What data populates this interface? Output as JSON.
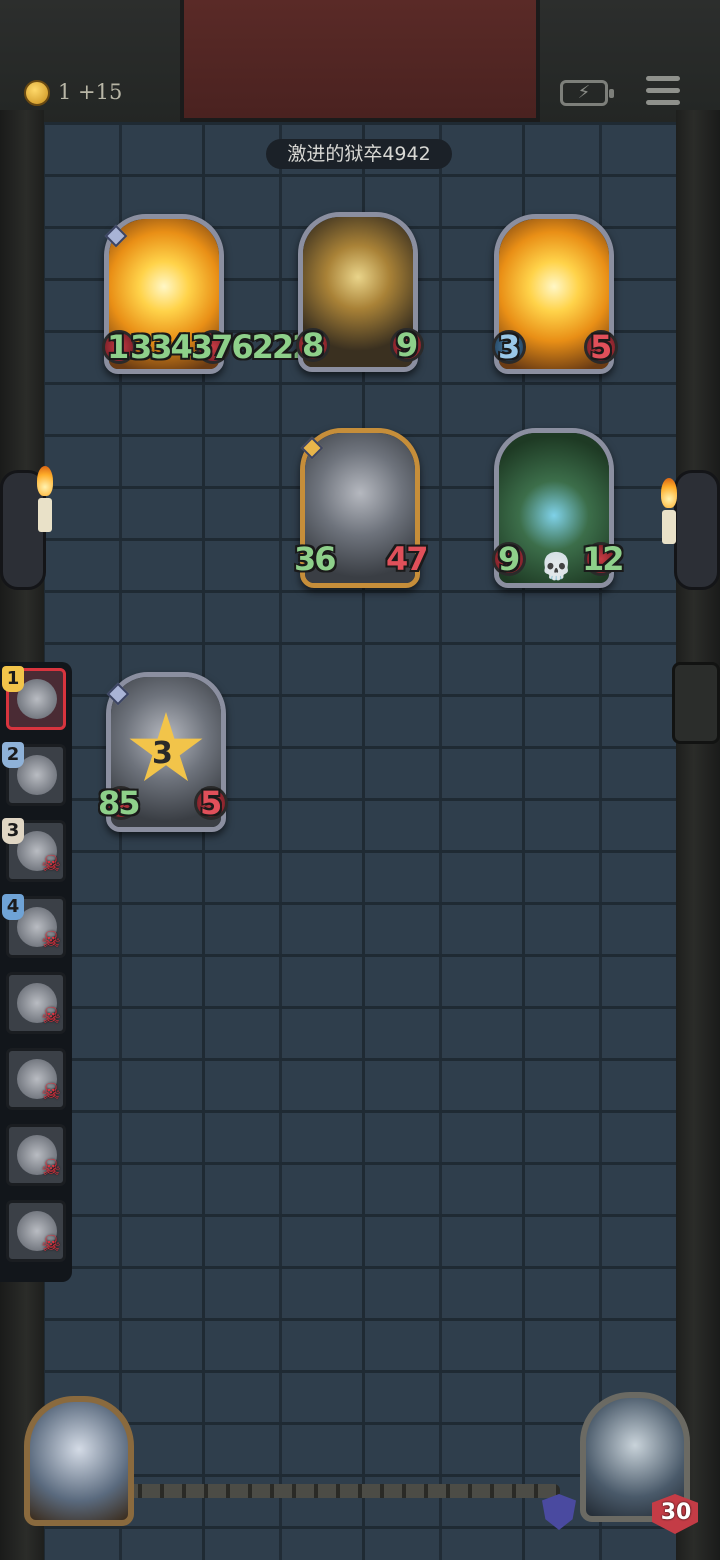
{
  "header": {
    "gold_text": "1 +15",
    "battery_glyph": "⚡",
    "opponent_name": "激进的狱卒4942"
  },
  "icons": {
    "gold": "gold-coin-icon",
    "battery": "battery-icon",
    "menu": "menu-icon",
    "skull": "💀",
    "dead_mark": "☠"
  },
  "board": {
    "enemy_top": [
      {
        "name": "glowing-card-1",
        "attack": "1",
        "health": "334376222"
      },
      {
        "name": "boss-card",
        "attack": "8",
        "health": "9"
      },
      {
        "name": "glowing-card-2",
        "attack": "3",
        "health": "5"
      }
    ],
    "enemy_mid": [
      {
        "name": "knight-card",
        "attack": "36",
        "health": "47"
      },
      {
        "name": "vine-card",
        "attack": "9",
        "health": "12"
      }
    ],
    "player_unit": {
      "attack": "85",
      "health": "5",
      "star_level": "3"
    }
  },
  "sidebar": {
    "items": [
      {
        "num": "1",
        "state": "active"
      },
      {
        "num": "2",
        "state": "alive"
      },
      {
        "num": "3",
        "state": "dead"
      },
      {
        "num": "4",
        "state": "dead"
      },
      {
        "num": "",
        "state": "dead"
      },
      {
        "num": "",
        "state": "dead"
      },
      {
        "num": "",
        "state": "dead"
      },
      {
        "num": "",
        "state": "dead"
      }
    ]
  },
  "footer": {
    "enemy_hero_hp": "30"
  },
  "colors": {
    "attack": "#8ed08a",
    "health": "#e0505a",
    "active_border": "#d8343e",
    "wall": "#2f3e4c"
  }
}
